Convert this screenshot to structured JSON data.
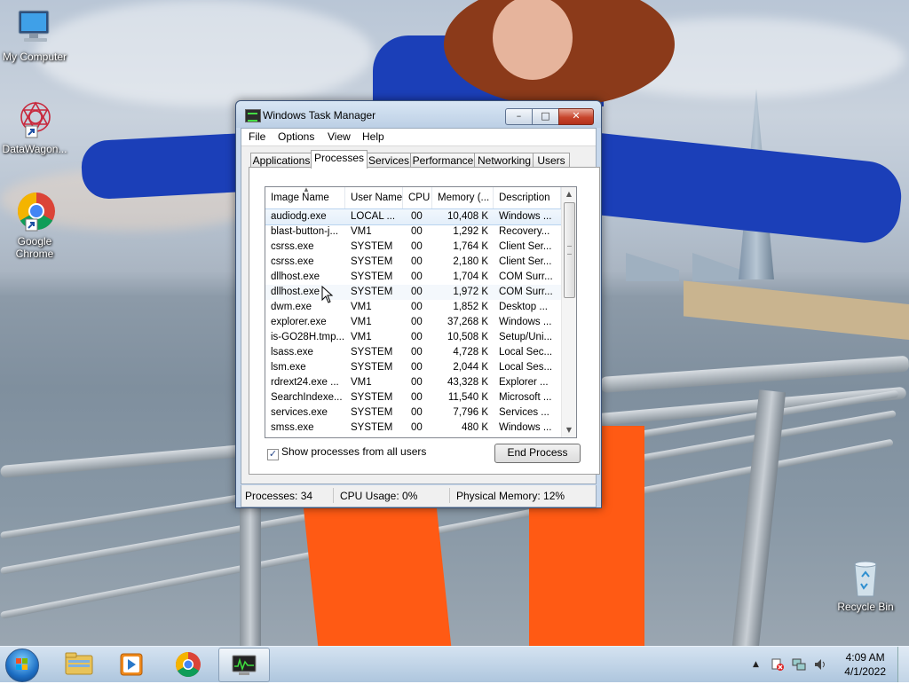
{
  "desktop": {
    "icons": [
      {
        "label": "My Computer",
        "icon": "computer-icon"
      },
      {
        "label": "DataWagon...",
        "icon": "datawagon-icon"
      },
      {
        "label": "Google Chrome",
        "icon": "chrome-icon"
      },
      {
        "label": "Recycle Bin",
        "icon": "recycle-bin-icon"
      }
    ]
  },
  "window": {
    "title": "Windows Task Manager",
    "controls": {
      "minimize": "–",
      "maximize": "□",
      "close": "✕"
    },
    "menu": [
      "File",
      "Options",
      "View",
      "Help"
    ],
    "tabs": [
      "Applications",
      "Processes",
      "Services",
      "Performance",
      "Networking",
      "Users"
    ],
    "active_tab": "Processes",
    "columns": [
      "Image Name",
      "User Name",
      "CPU",
      "Memory (...",
      "Description"
    ],
    "rows": [
      {
        "name": "audiodg.exe",
        "user": "LOCAL ...",
        "cpu": "00",
        "mem": "10,408 K",
        "desc": "Windows ..."
      },
      {
        "name": "blast-button-j...",
        "user": "VM1",
        "cpu": "00",
        "mem": "1,292 K",
        "desc": "Recovery..."
      },
      {
        "name": "csrss.exe",
        "user": "SYSTEM",
        "cpu": "00",
        "mem": "1,764 K",
        "desc": "Client Ser..."
      },
      {
        "name": "csrss.exe",
        "user": "SYSTEM",
        "cpu": "00",
        "mem": "2,180 K",
        "desc": "Client Ser..."
      },
      {
        "name": "dllhost.exe",
        "user": "SYSTEM",
        "cpu": "00",
        "mem": "1,704 K",
        "desc": "COM Surr..."
      },
      {
        "name": "dllhost.exe",
        "user": "SYSTEM",
        "cpu": "00",
        "mem": "1,972 K",
        "desc": "COM Surr..."
      },
      {
        "name": "dwm.exe",
        "user": "VM1",
        "cpu": "00",
        "mem": "1,852 K",
        "desc": "Desktop ..."
      },
      {
        "name": "explorer.exe",
        "user": "VM1",
        "cpu": "00",
        "mem": "37,268 K",
        "desc": "Windows ..."
      },
      {
        "name": "is-GO28H.tmp...",
        "user": "VM1",
        "cpu": "00",
        "mem": "10,508 K",
        "desc": "Setup/Uni..."
      },
      {
        "name": "lsass.exe",
        "user": "SYSTEM",
        "cpu": "00",
        "mem": "4,728 K",
        "desc": "Local Sec..."
      },
      {
        "name": "lsm.exe",
        "user": "SYSTEM",
        "cpu": "00",
        "mem": "2,044 K",
        "desc": "Local Ses..."
      },
      {
        "name": "rdrext24.exe ...",
        "user": "VM1",
        "cpu": "00",
        "mem": "43,328 K",
        "desc": "Explorer ..."
      },
      {
        "name": "SearchIndexe...",
        "user": "SYSTEM",
        "cpu": "00",
        "mem": "11,540 K",
        "desc": "Microsoft ..."
      },
      {
        "name": "services.exe",
        "user": "SYSTEM",
        "cpu": "00",
        "mem": "7,796 K",
        "desc": "Services ..."
      },
      {
        "name": "smss.exe",
        "user": "SYSTEM",
        "cpu": "00",
        "mem": "480 K",
        "desc": "Windows ..."
      }
    ],
    "show_all_label": "Show processes from all users",
    "show_all_checked": true,
    "end_process_label": "End Process",
    "status": {
      "processes": "Processes: 34",
      "cpu": "CPU Usage: 0%",
      "memory": "Physical Memory: 12%"
    }
  },
  "taskbar": {
    "pinned": [
      "start-button",
      "explorer-icon",
      "media-player-icon",
      "chrome-icon",
      "task-manager-icon"
    ],
    "active": "task-manager-icon",
    "time": "4:09 AM",
    "date": "4/1/2022"
  }
}
